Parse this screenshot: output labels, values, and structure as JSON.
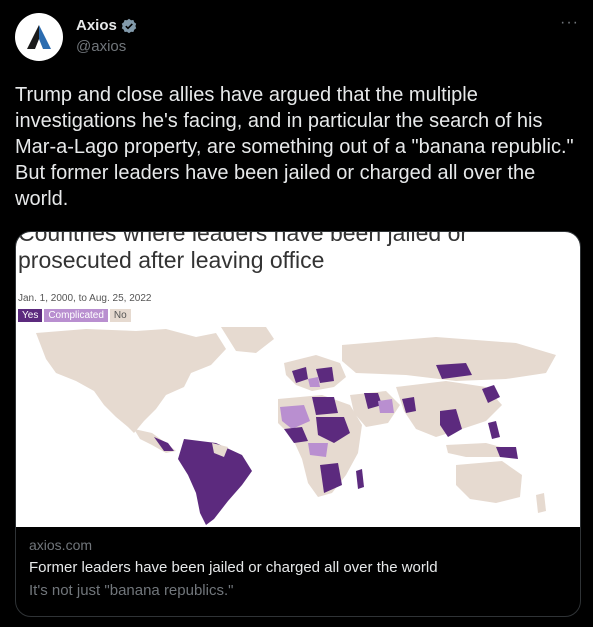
{
  "tweet": {
    "author_name": "Axios",
    "author_handle": "@axios",
    "more_label": "···",
    "text": "Trump and close allies have argued that the multiple investigations he's facing, and in particular the search of his Mar-a-Lago property, are something out of a \"banana republic.\" But former leaders have been jailed or charged all over the world."
  },
  "card": {
    "chart_title": "Countries where leaders have been jailed or prosecuted after leaving office",
    "chart_subtitle": "Jan. 1, 2000, to Aug. 25, 2022",
    "legend": [
      {
        "label": "Yes",
        "color": "#5c2a7e"
      },
      {
        "label": "Complicated",
        "color": "#b98fd0"
      },
      {
        "label": "No",
        "color": "#e6dad0"
      }
    ],
    "domain": "axios.com",
    "title": "Former leaders have been jailed or charged all over the world",
    "description": "It's not just \"banana republics.\""
  },
  "colors": {
    "background": "#000000",
    "text_primary": "#e7e9ea",
    "text_secondary": "#71767b",
    "verified": "#829aab",
    "map_yes": "#5c2a7e",
    "map_complicated": "#b98fd0",
    "map_no": "#e6dad0"
  }
}
